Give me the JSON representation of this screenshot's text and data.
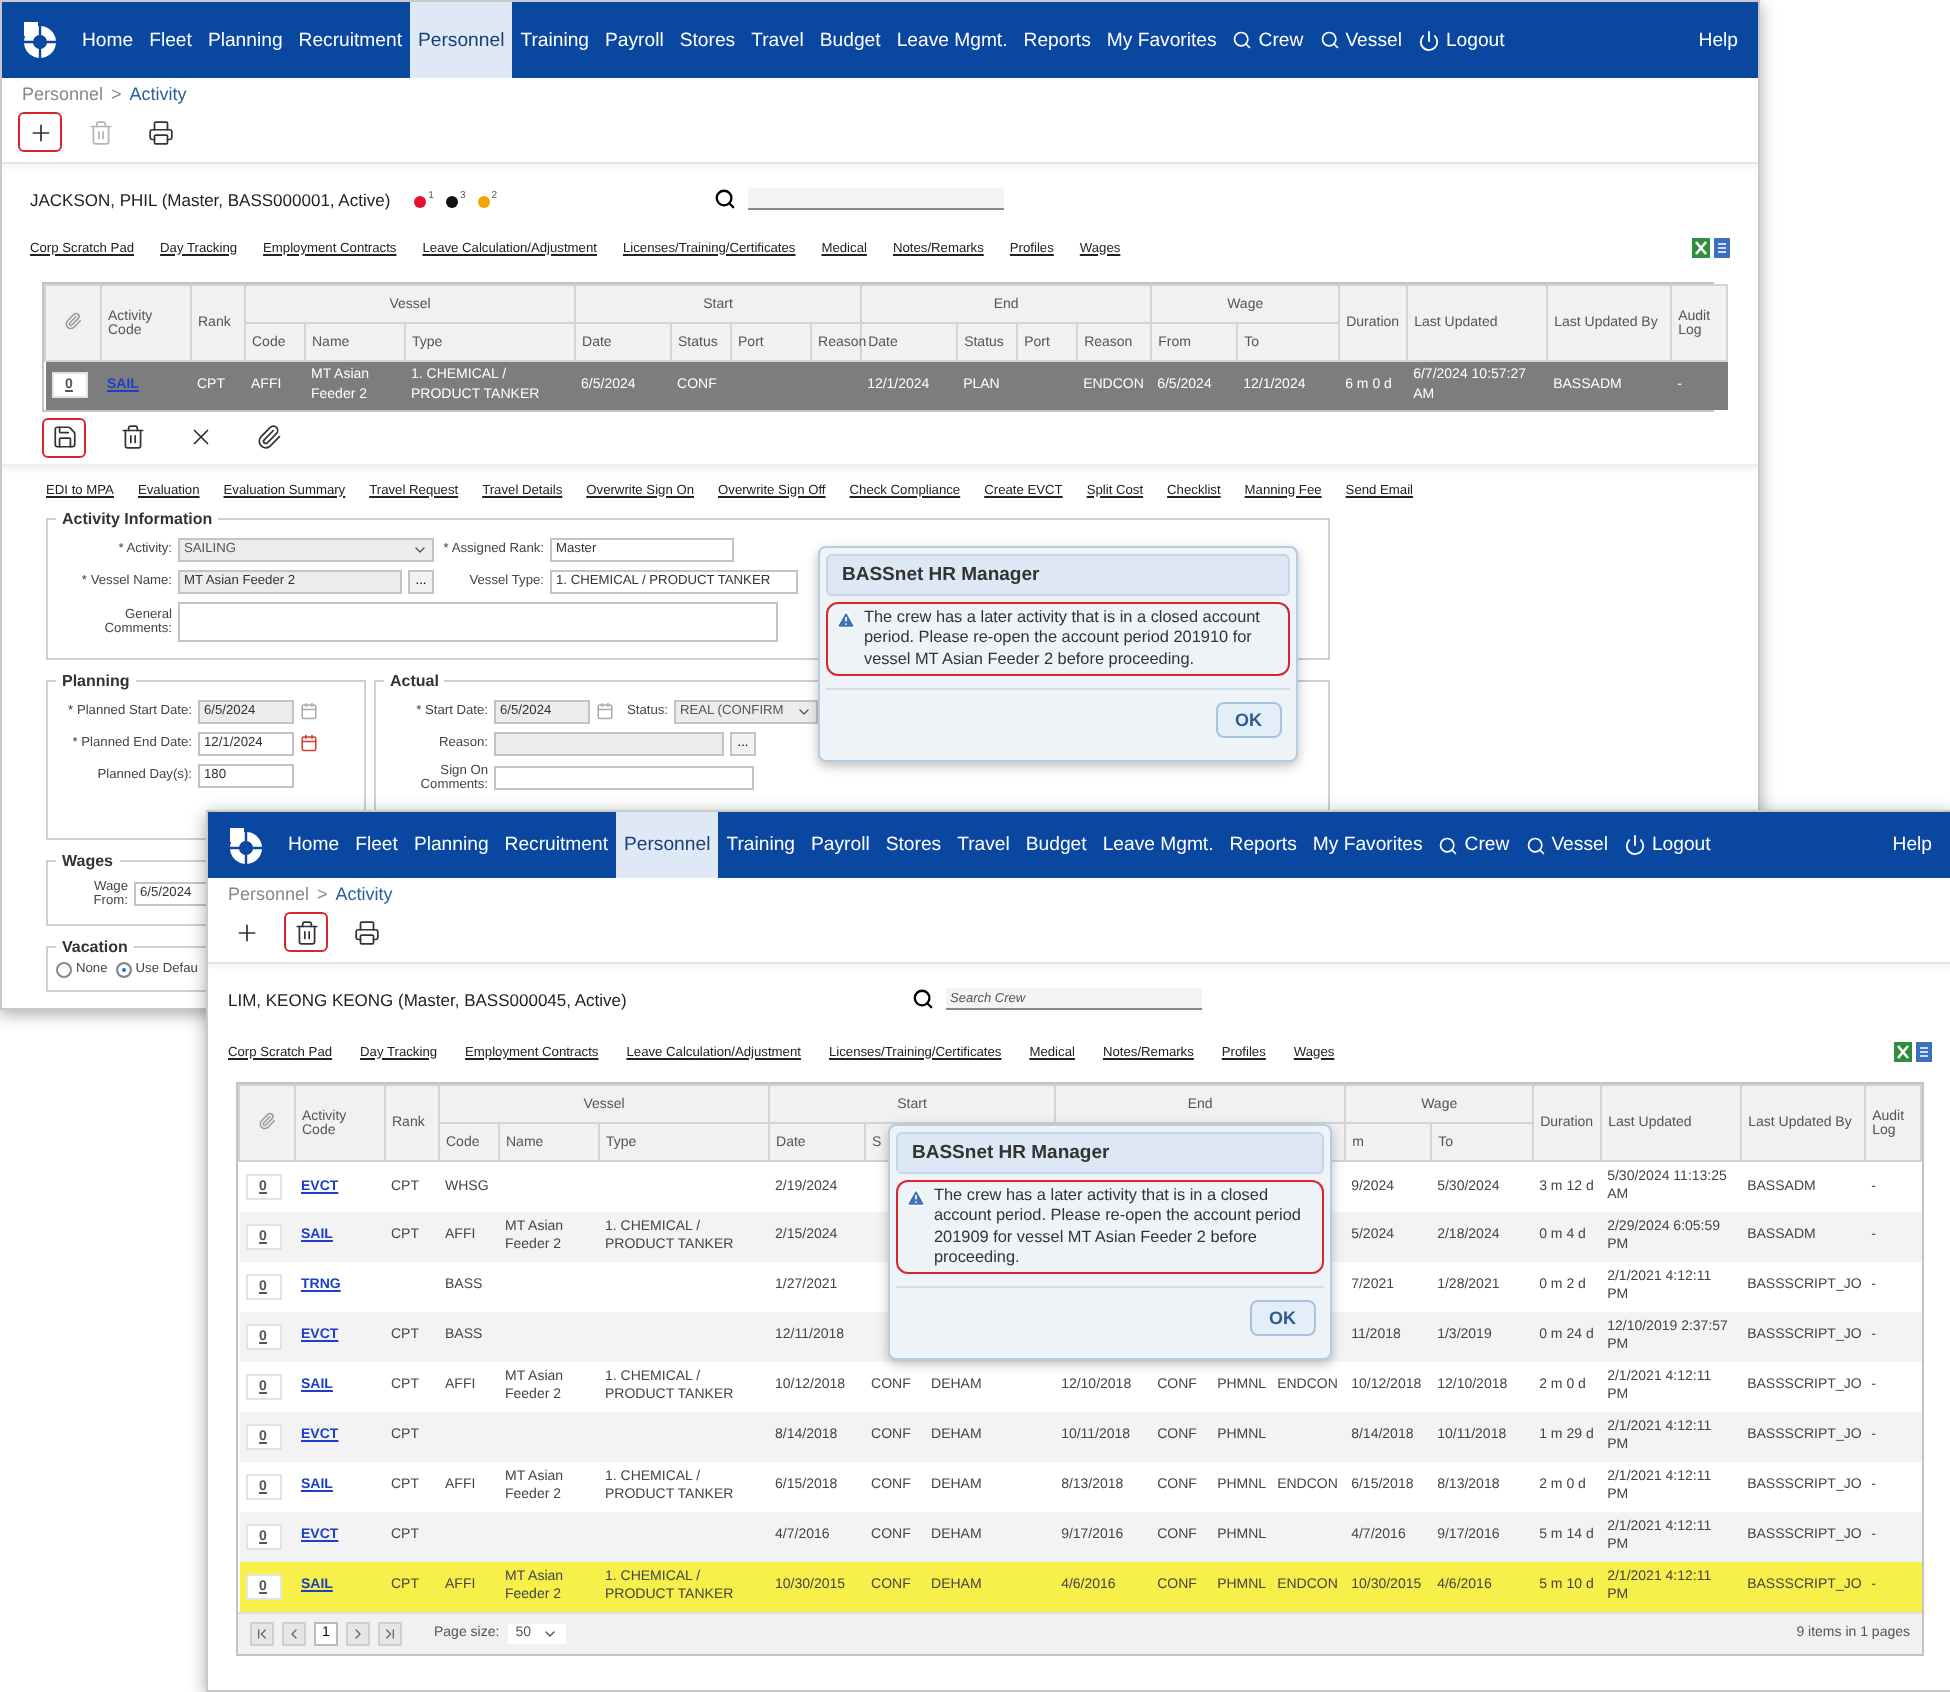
{
  "windows": [
    {
      "nav": {
        "items": [
          {
            "label": "Home",
            "kind": "link",
            "selected": false
          },
          {
            "label": "Fleet",
            "kind": "link",
            "selected": false
          },
          {
            "label": "Planning",
            "kind": "link",
            "selected": false
          },
          {
            "label": "Recruitment",
            "kind": "link",
            "selected": false
          },
          {
            "label": "Personnel",
            "kind": "link",
            "selected": true
          },
          {
            "label": "Training",
            "kind": "link",
            "selected": false
          },
          {
            "label": "Payroll",
            "kind": "link",
            "selected": false
          },
          {
            "label": "Stores",
            "kind": "link",
            "selected": false
          },
          {
            "label": "Travel",
            "kind": "link",
            "selected": false
          },
          {
            "label": "Budget",
            "kind": "link",
            "selected": false
          },
          {
            "label": "Leave Mgmt.",
            "kind": "link",
            "selected": false
          },
          {
            "label": "Reports",
            "kind": "link",
            "selected": false
          },
          {
            "label": "My Favorites",
            "kind": "link",
            "selected": false
          },
          {
            "label": "Crew",
            "kind": "search",
            "selected": false
          },
          {
            "label": "Vessel",
            "kind": "search",
            "selected": false
          },
          {
            "label": "Logout",
            "kind": "logout",
            "selected": false
          }
        ],
        "help": "Help"
      },
      "breadcrumb": {
        "parent": "Personnel",
        "separator": ">",
        "current": "Activity"
      },
      "toolbar": [
        {
          "kind": "add",
          "highlighted": true,
          "disabled": false
        },
        {
          "kind": "delete",
          "highlighted": false,
          "disabled": true
        },
        {
          "kind": "print",
          "highlighted": false,
          "disabled": false
        }
      ],
      "crew": {
        "name": "JACKSON, PHIL (Master, BASS000001, Active)",
        "flags": [
          {
            "color": "#e8112d",
            "count": "1"
          },
          {
            "color": "#111111",
            "count": "3"
          },
          {
            "color": "#f5a300",
            "count": "2"
          }
        ]
      },
      "links": [
        "Corp Scratch Pad",
        "Day Tracking",
        "Employment Contracts",
        "Leave Calculation/Adjustment",
        "Licenses/Training/Certificates",
        "Medical",
        "Notes/Remarks",
        "Profiles",
        "Wages"
      ],
      "table": {
        "header": [
          {
            "kind": "attach"
          },
          {
            "label": "Activity Code"
          },
          {
            "label": "Rank"
          },
          {
            "group": "Vessel",
            "columns": [
              "Code",
              "Name",
              "Type"
            ]
          },
          {
            "group": "Start",
            "columns": [
              "Date",
              "Status",
              "Port",
              "Reason"
            ]
          },
          {
            "group": "End",
            "columns": [
              "Date",
              "Status",
              "Port",
              "Reason"
            ]
          },
          {
            "group": "Wage",
            "columns": [
              "From",
              "To"
            ]
          },
          {
            "label": "Duration"
          },
          {
            "label": "Last Updated"
          },
          {
            "label": "Last Updated By"
          },
          {
            "label": "Audit Log"
          }
        ],
        "rows": [
          {
            "selected": false,
            "editing": true,
            "cells": {
              "count": "0",
              "activity": "SAIL",
              "rank": "CPT",
              "vessel_code": "AFFI",
              "vessel_name": "MT Asian Feeder 2",
              "vessel_type": "1. CHEMICAL / PRODUCT TANKER",
              "start_date": "6/5/2024",
              "start_status": "CONF",
              "end_date": "12/1/2024",
              "end_status": "PLAN",
              "end_reason": "ENDCON",
              "wage_from": "6/5/2024",
              "wage_to": "12/1/2024",
              "duration": "6 m 0 d",
              "last_updated": "6/7/2024 10:57:27 AM",
              "updated_by": "BASSADM",
              "audit_log": "-"
            }
          }
        ]
      },
      "row_actions": [
        {
          "kind": "save",
          "highlighted": true
        },
        {
          "kind": "delete",
          "highlighted": false
        },
        {
          "kind": "cancel",
          "highlighted": false
        },
        {
          "kind": "attach",
          "highlighted": false
        }
      ],
      "activity_links": [
        "EDI to MPA",
        "Evaluation",
        "Evaluation Summary",
        "Travel Request",
        "Travel Details",
        "Overwrite Sign On",
        "Overwrite Sign Off",
        "Check Compliance",
        "Create EVCT",
        "Split Cost",
        "Checklist",
        "Manning Fee",
        "Send Email"
      ],
      "activity_info": {
        "title": "Activity Information",
        "rows": [
          [
            {
              "label": "* Activity:",
              "kind": "select",
              "value": "SAILING",
              "disabled": true
            },
            {
              "label": "* Assigned Rank:",
              "kind": "text",
              "value": "Master",
              "disabled": false
            }
          ],
          [
            {
              "label": "* Vessel Name:",
              "kind": "lookup",
              "value": "MT Asian Feeder 2",
              "button": "...",
              "disabled": true
            },
            {
              "label": "Vessel Type:",
              "kind": "text",
              "value": "1. CHEMICAL / PRODUCT TANKER",
              "disabled": false
            }
          ],
          [
            {
              "label": "General Comments:",
              "kind": "textarea",
              "disabled": false
            }
          ]
        ]
      },
      "planning": {
        "title": "Planning",
        "rows": [
          [
            {
              "label": "* Planned Start Date:",
              "kind": "date",
              "value": "6/5/2024",
              "disabled": true
            }
          ],
          [
            {
              "label": "* Planned End Date:",
              "kind": "date",
              "value": "12/1/2024",
              "disabled": false
            }
          ],
          [
            {
              "label": "Planned Day(s):",
              "kind": "text",
              "value": "180",
              "disabled": false
            }
          ]
        ]
      },
      "actual": {
        "title": "Actual",
        "rows": [
          [
            {
              "label": "* Start Date:",
              "kind": "date",
              "value": "6/5/2024",
              "disabled": true
            },
            {
              "label": "Status:",
              "kind": "select",
              "value": "REAL (CONFIRM",
              "disabled": true
            }
          ],
          [
            {
              "label": "Reason:",
              "kind": "lookup",
              "button": "...",
              "disabled": true
            }
          ],
          [
            {
              "label": "Sign On Comments:",
              "kind": "text",
              "disabled": false
            }
          ]
        ]
      },
      "wages": {
        "title": "Wages",
        "rows": [
          [
            {
              "label": "Wage From:",
              "kind": "text",
              "value": "6/5/2024",
              "disabled": false
            }
          ]
        ]
      },
      "vacation": {
        "title": "Vacation",
        "options": [
          {
            "label": "None",
            "selected": false
          },
          {
            "label": "Use Defau",
            "selected": true
          }
        ]
      },
      "dialog": {
        "title": "BASSnet HR Manager",
        "message": "The crew has a later activity that is in a closed account period. Please re-open the account period 201910 for vessel MT Asian Feeder 2 before proceeding.",
        "highlighted": true,
        "button": "OK"
      }
    },
    {
      "nav": {
        "items": [
          {
            "label": "Home",
            "kind": "link",
            "selected": false
          },
          {
            "label": "Fleet",
            "kind": "link",
            "selected": false
          },
          {
            "label": "Planning",
            "kind": "link",
            "selected": false
          },
          {
            "label": "Recruitment",
            "kind": "link",
            "selected": false
          },
          {
            "label": "Personnel",
            "kind": "link",
            "selected": true
          },
          {
            "label": "Training",
            "kind": "link",
            "selected": false
          },
          {
            "label": "Payroll",
            "kind": "link",
            "selected": false
          },
          {
            "label": "Stores",
            "kind": "link",
            "selected": false
          },
          {
            "label": "Travel",
            "kind": "link",
            "selected": false
          },
          {
            "label": "Budget",
            "kind": "link",
            "selected": false
          },
          {
            "label": "Leave Mgmt.",
            "kind": "link",
            "selected": false
          },
          {
            "label": "Reports",
            "kind": "link",
            "selected": false
          },
          {
            "label": "My Favorites",
            "kind": "link",
            "selected": false
          },
          {
            "label": "Crew",
            "kind": "search",
            "selected": false
          },
          {
            "label": "Vessel",
            "kind": "search",
            "selected": false
          },
          {
            "label": "Logout",
            "kind": "logout",
            "selected": false
          }
        ],
        "help": "Help"
      },
      "breadcrumb": {
        "parent": "Personnel",
        "separator": ">",
        "current": "Activity"
      },
      "toolbar": [
        {
          "kind": "add",
          "highlighted": false,
          "disabled": false
        },
        {
          "kind": "delete",
          "highlighted": true,
          "disabled": false
        },
        {
          "kind": "print",
          "highlighted": false,
          "disabled": false
        }
      ],
      "crew": {
        "name": "LIM, KEONG KEONG (Master, BASS000045, Active)"
      },
      "search": {
        "placeholder": "Search Crew"
      },
      "links": [
        "Corp Scratch Pad",
        "Day Tracking",
        "Employment Contracts",
        "Leave Calculation/Adjustment",
        "Licenses/Training/Certificates",
        "Medical",
        "Notes/Remarks",
        "Profiles",
        "Wages"
      ],
      "table": {
        "header": [
          {
            "kind": "attach"
          },
          {
            "label": "Activity Code"
          },
          {
            "label": "Rank"
          },
          {
            "group": "Vessel",
            "columns": [
              "Code",
              "Name",
              "Type"
            ]
          },
          {
            "group": "Start",
            "columns": [
              "Date",
              "S",
              null,
              null
            ]
          },
          {
            "group": "End",
            "columns": [
              null,
              null,
              null,
              null
            ]
          },
          {
            "group": "Wage",
            "columns": [
              "m",
              "To"
            ]
          },
          {
            "label": "Duration"
          },
          {
            "label": "Last Updated"
          },
          {
            "label": "Last Updated By"
          },
          {
            "label": "Audit Log"
          }
        ],
        "rows": [
          {
            "selected": false,
            "cells": {
              "count": "0",
              "activity": "EVCT",
              "rank": "CPT",
              "vessel_code": "WHSG",
              "start_date": "2/19/2024",
              "wage_from": "9/2024",
              "wage_to": "5/30/2024",
              "duration": "3 m 12 d",
              "last_updated": "5/30/2024 11:13:25 AM",
              "updated_by": "BASSADM",
              "audit_log": "-"
            }
          },
          {
            "selected": false,
            "cells": {
              "count": "0",
              "activity": "SAIL",
              "rank": "CPT",
              "vessel_code": "AFFI",
              "vessel_name": "MT Asian Feeder 2",
              "vessel_type": "1. CHEMICAL / PRODUCT TANKER",
              "start_date": "2/15/2024",
              "wage_from": "5/2024",
              "wage_to": "2/18/2024",
              "duration": "0 m 4 d",
              "last_updated": "2/29/2024 6:05:59 PM",
              "updated_by": "BASSADM",
              "audit_log": "-"
            }
          },
          {
            "selected": false,
            "cells": {
              "count": "0",
              "activity": "TRNG",
              "vessel_code": "BASS",
              "start_date": "1/27/2021",
              "wage_from": "7/2021",
              "wage_to": "1/28/2021",
              "duration": "0 m 2 d",
              "last_updated": "2/1/2021 4:12:11 PM",
              "updated_by": "BASSSCRIPT_JO",
              "audit_log": "-"
            }
          },
          {
            "selected": false,
            "cells": {
              "count": "0",
              "activity": "EVCT",
              "rank": "CPT",
              "vessel_code": "BASS",
              "start_date": "12/11/2018",
              "wage_from": "11/2018",
              "wage_to": "1/3/2019",
              "duration": "0 m 24 d",
              "last_updated": "12/10/2019 2:37:57 PM",
              "updated_by": "BASSSCRIPT_JO",
              "audit_log": "-"
            }
          },
          {
            "selected": false,
            "cells": {
              "count": "0",
              "activity": "SAIL",
              "rank": "CPT",
              "vessel_code": "AFFI",
              "vessel_name": "MT Asian Feeder 2",
              "vessel_type": "1. CHEMICAL / PRODUCT TANKER",
              "start_date": "10/12/2018",
              "start_status": "CONF",
              "start_port": "DEHAM",
              "end_date": "12/10/2018",
              "end_status": "CONF",
              "end_port": "PHMNL",
              "end_reason": "ENDCON",
              "wage_from": "10/12/2018",
              "wage_to": "12/10/2018",
              "duration": "2 m 0 d",
              "last_updated": "2/1/2021 4:12:11 PM",
              "updated_by": "BASSSCRIPT_JO",
              "audit_log": "-"
            }
          },
          {
            "selected": false,
            "cells": {
              "count": "0",
              "activity": "EVCT",
              "rank": "CPT",
              "start_date": "8/14/2018",
              "start_status": "CONF",
              "start_port": "DEHAM",
              "end_date": "10/11/2018",
              "end_status": "CONF",
              "end_port": "PHMNL",
              "wage_from": "8/14/2018",
              "wage_to": "10/11/2018",
              "duration": "1 m 29 d",
              "last_updated": "2/1/2021 4:12:11 PM",
              "updated_by": "BASSSCRIPT_JO",
              "audit_log": "-"
            }
          },
          {
            "selected": false,
            "cells": {
              "count": "0",
              "activity": "SAIL",
              "rank": "CPT",
              "vessel_code": "AFFI",
              "vessel_name": "MT Asian Feeder 2",
              "vessel_type": "1. CHEMICAL / PRODUCT TANKER",
              "start_date": "6/15/2018",
              "start_status": "CONF",
              "start_port": "DEHAM",
              "end_date": "8/13/2018",
              "end_status": "CONF",
              "end_port": "PHMNL",
              "end_reason": "ENDCON",
              "wage_from": "6/15/2018",
              "wage_to": "8/13/2018",
              "duration": "2 m 0 d",
              "last_updated": "2/1/2021 4:12:11 PM",
              "updated_by": "BASSSCRIPT_JO",
              "audit_log": "-"
            }
          },
          {
            "selected": false,
            "cells": {
              "count": "0",
              "activity": "EVCT",
              "rank": "CPT",
              "start_date": "4/7/2016",
              "start_status": "CONF",
              "start_port": "DEHAM",
              "end_date": "9/17/2016",
              "end_status": "CONF",
              "end_port": "PHMNL",
              "wage_from": "4/7/2016",
              "wage_to": "9/17/2016",
              "duration": "5 m 14 d",
              "last_updated": "2/1/2021 4:12:11 PM",
              "updated_by": "BASSSCRIPT_JO",
              "audit_log": "-"
            }
          },
          {
            "selected": true,
            "cells": {
              "count": "0",
              "activity": "SAIL",
              "rank": "CPT",
              "vessel_code": "AFFI",
              "vessel_name": "MT Asian Feeder 2",
              "vessel_type": "1. CHEMICAL / PRODUCT TANKER",
              "start_date": "10/30/2015",
              "start_status": "CONF",
              "start_port": "DEHAM",
              "end_date": "4/6/2016",
              "end_status": "CONF",
              "end_port": "PHMNL",
              "end_reason": "ENDCON",
              "wage_from": "10/30/2015",
              "wage_to": "4/6/2016",
              "duration": "5 m 10 d",
              "last_updated": "2/1/2021 4:12:11 PM",
              "updated_by": "BASSSCRIPT_JO",
              "audit_log": "-"
            }
          }
        ],
        "pager": {
          "page": "1",
          "size_label": "Page size:",
          "size": "50",
          "summary": "9 items in 1 pages"
        }
      },
      "dialog": {
        "title": "BASSnet HR Manager",
        "message": "The crew has a later activity that is in a closed account period. Please re-open the account period 201909 for vessel MT Asian Feeder 2 before proceeding.",
        "highlighted": true,
        "button": "OK"
      }
    }
  ]
}
